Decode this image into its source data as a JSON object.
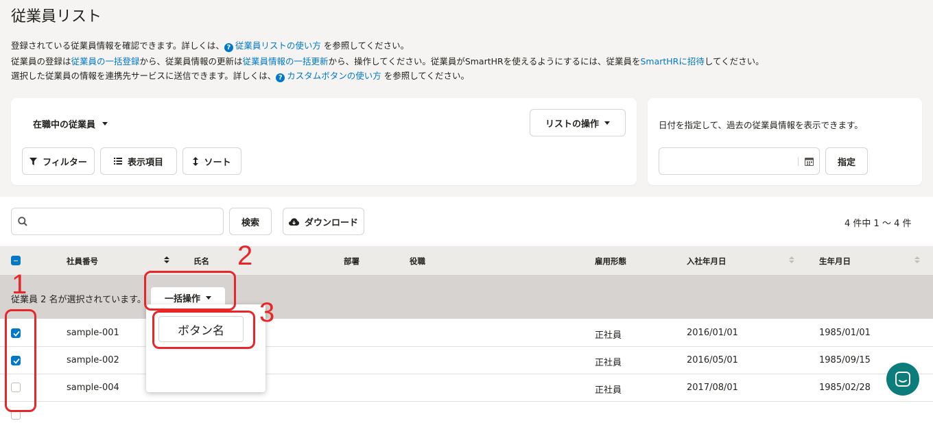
{
  "page": {
    "title": "従業員リスト",
    "desc1_pre": "登録されている従業員情報を確認できます。詳しくは、",
    "desc1_link": "従業員リストの使い方",
    "desc1_post": " を参照してください。",
    "desc2_a": "従業員の登録は",
    "desc2_link1": "従業員の一括登録",
    "desc2_b": "から、従業員情報の更新は",
    "desc2_link2": "従業員情報の一括更新",
    "desc2_c": "から、操作してください。従業員がSmartHRを使えるようにするには、従業員を",
    "desc2_link3": "SmartHRに招待",
    "desc2_d": "してください。",
    "desc3_pre": "選択した従業員の情報を連携先サービスに送信できます。詳しくは、",
    "desc3_link": "カスタムボタンの使い方",
    "desc3_post": " を参照してください。"
  },
  "filter_card": {
    "status_select": "在職中の従業員",
    "list_ops_button": "リストの操作",
    "filter_button": "フィルター",
    "columns_button": "表示項目",
    "sort_button": "ソート"
  },
  "date_card": {
    "text": "日付を指定して、過去の従業員情報を表示できます。",
    "date_value": "",
    "apply_button": "指定"
  },
  "toolbar": {
    "search_placeholder": "",
    "search_button": "検索",
    "download_button": "ダウンロード",
    "count_text": "4 件中 1 〜 4 件"
  },
  "table": {
    "headers": [
      "社員番号",
      "氏名",
      "部署",
      "役職",
      "雇用形態",
      "入社年月日",
      "生年月日"
    ],
    "selection_text": "従業員 2 名が選択されています。",
    "bulk_button": "一括操作",
    "menu_item": "ボタン名",
    "rows": [
      {
        "id": "sample-001",
        "type": "正社員",
        "joined": "2016/01/01",
        "birth": "1985/01/01",
        "checked": true
      },
      {
        "id": "sample-002",
        "type": "正社員",
        "joined": "2016/05/01",
        "birth": "1985/09/15",
        "checked": true
      },
      {
        "id": "sample-004",
        "type": "正社員",
        "joined": "2017/08/01",
        "birth": "1985/02/28",
        "checked": false
      }
    ]
  },
  "annotations": {
    "n1": "1",
    "n2": "2",
    "n3": "3"
  },
  "colors": {
    "accent": "#0077c7",
    "annotation_red": "#e8262a",
    "chat_bubble": "#0d7d7b"
  }
}
